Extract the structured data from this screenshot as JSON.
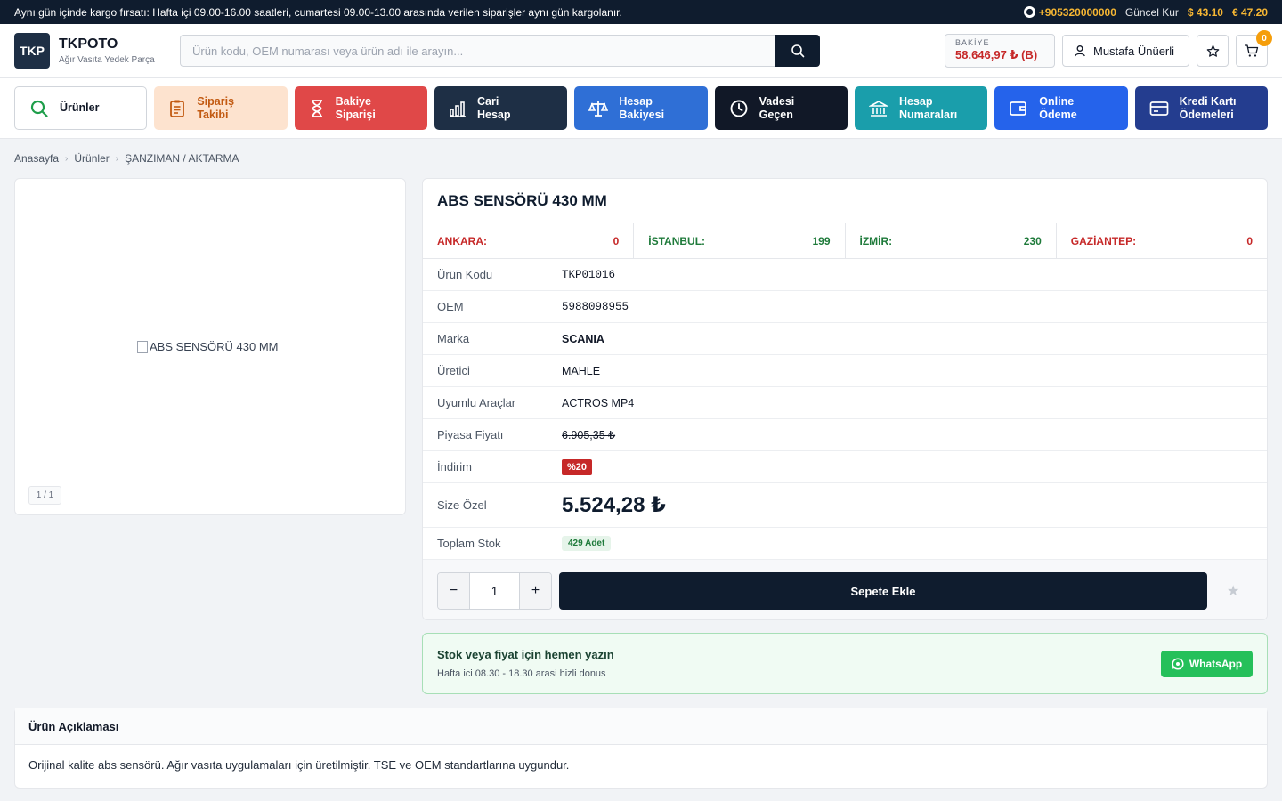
{
  "topbar": {
    "announcement": "Aynı gün içinde kargo fırsatı: Hafta içi 09.00-16.00 saatleri, cumartesi 09.00-13.00 arasında verilen siparişler aynı gün kargolanır.",
    "phone": "+905320000000",
    "kur_label": "Güncel Kur",
    "usd": "$ 43.10",
    "eur": "€ 47.20"
  },
  "header": {
    "logo": "TKP",
    "brand": "TKPOTO",
    "tagline": "Ağır Vasıta Yedek Parça",
    "search_placeholder": "Ürün kodu, OEM numarası veya ürün adı ile arayın...",
    "balance_label": "BAKİYE",
    "balance_value": "58.646,97 ₺ (B)",
    "user_name": "Mustafa Ünüerli",
    "cart_count": "0"
  },
  "nav": {
    "tiles": [
      {
        "label": "Ürünler"
      },
      {
        "label": "Sipariş\nTakibi"
      },
      {
        "label": "Bakiye\nSiparişi"
      },
      {
        "label": "Cari\nHesap"
      },
      {
        "label": "Hesap\nBakiyesi"
      },
      {
        "label": "Vadesi\nGeçen"
      },
      {
        "label": "Hesap\nNumaraları"
      },
      {
        "label": "Online\nÖdeme"
      },
      {
        "label": "Kredi Kartı\nÖdemeleri"
      }
    ]
  },
  "breadcrumb": [
    "Anasayfa",
    "Ürünler",
    "ŞANZIMAN / AKTARMA"
  ],
  "gallery": {
    "image_alt": "ABS SENSÖRÜ 430 MM",
    "counter": "1 / 1"
  },
  "product": {
    "title": "ABS SENSÖRÜ 430 MM",
    "stocks": [
      {
        "city": "ANKARA:",
        "qty": "0",
        "status": "out"
      },
      {
        "city": "İSTANBUL:",
        "qty": "199",
        "status": "in"
      },
      {
        "city": "İZMİR:",
        "qty": "230",
        "status": "in"
      },
      {
        "city": "GAZİANTEP:",
        "qty": "0",
        "status": "out"
      }
    ],
    "labels": {
      "code": "Ürün Kodu",
      "oem": "OEM",
      "brand": "Marka",
      "maker": "Üretici",
      "vehicles": "Uyumlu Araçlar",
      "market_price": "Piyasa Fiyatı",
      "discount": "İndirim",
      "special_price": "Size Özel",
      "total_stock": "Toplam Stok"
    },
    "code": "TKP01016",
    "oem": "5988098955",
    "brand": "SCANIA",
    "maker": "MAHLE",
    "vehicles": "ACTROS MP4",
    "market_price": "6.905,35 ₺",
    "discount": "%20",
    "special_price": "5.524,28 ₺",
    "total_stock": "429 Adet",
    "quantity": "1",
    "add_to_cart": "Sepete Ekle"
  },
  "whatsapp": {
    "title": "Stok veya fiyat için hemen yazın",
    "subtitle": "Hafta ici 08.30 - 18.30 arasi hizli donus",
    "button": "WhatsApp"
  },
  "description": {
    "heading": "Ürün Açıklaması",
    "text": "Orijinal kalite abs sensörü. Ağır vasıta uygulamaları için üretilmiştir. TSE ve OEM standartlarına uygundur."
  },
  "colors": {
    "navy": "#0f1c2e",
    "accent_gold": "#f7b733",
    "price_red": "#c62828",
    "stock_green": "#1e7a3a"
  }
}
